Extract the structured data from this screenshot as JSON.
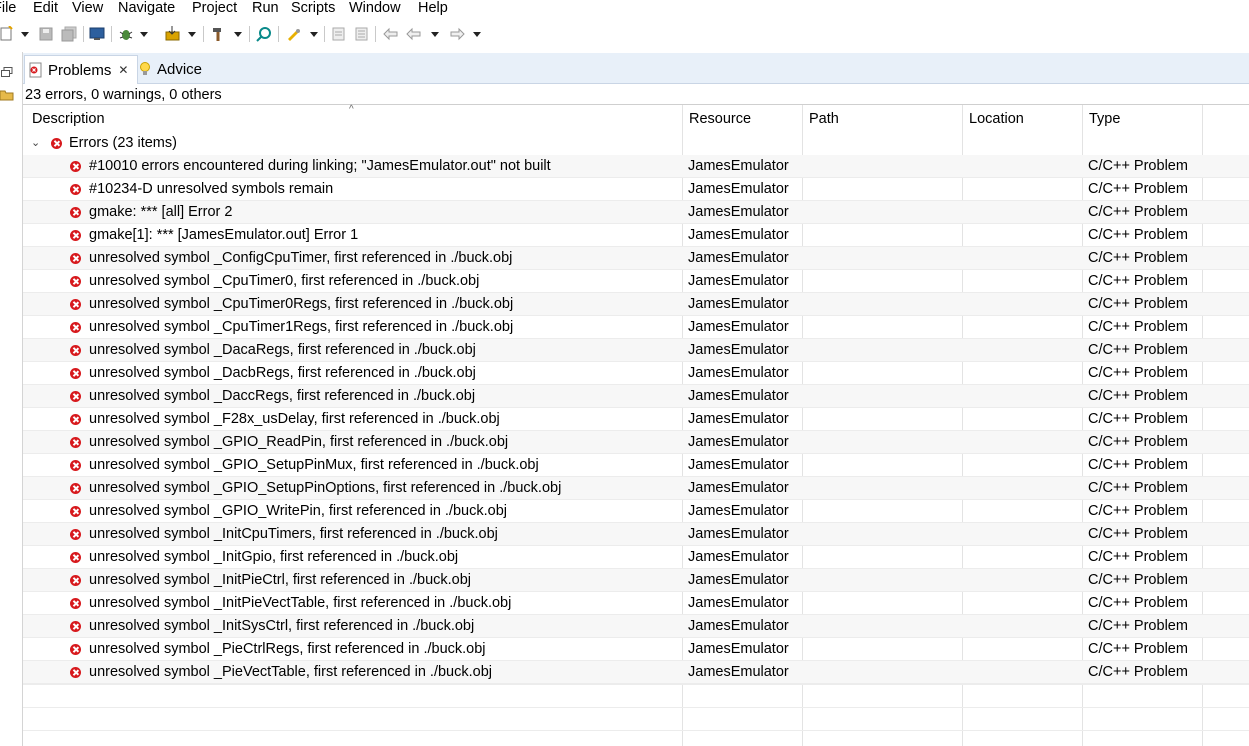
{
  "menu": [
    "File",
    "Edit",
    "View",
    "Navigate",
    "Project",
    "Run",
    "Scripts",
    "Window",
    "Help"
  ],
  "tabs": {
    "problems": "Problems",
    "advice": "Advice"
  },
  "summary": "23 errors, 0 warnings, 0 others",
  "columns": {
    "description": "Description",
    "resource": "Resource",
    "path": "Path",
    "location": "Location",
    "type": "Type"
  },
  "group": {
    "label": "Errors (23 items)"
  },
  "rows": [
    {
      "description": "#10010 errors encountered during linking; \"JamesEmulator.out\" not built",
      "resource": "JamesEmulator",
      "type": "C/C++ Problem"
    },
    {
      "description": "#10234-D unresolved symbols remain",
      "resource": "JamesEmulator",
      "type": "C/C++ Problem"
    },
    {
      "description": "gmake: *** [all] Error 2",
      "resource": "JamesEmulator",
      "type": "C/C++ Problem"
    },
    {
      "description": "gmake[1]: *** [JamesEmulator.out] Error 1",
      "resource": "JamesEmulator",
      "type": "C/C++ Problem"
    },
    {
      "description": "unresolved symbol _ConfigCpuTimer, first referenced in ./buck.obj",
      "resource": "JamesEmulator",
      "type": "C/C++ Problem"
    },
    {
      "description": "unresolved symbol _CpuTimer0, first referenced in ./buck.obj",
      "resource": "JamesEmulator",
      "type": "C/C++ Problem"
    },
    {
      "description": "unresolved symbol _CpuTimer0Regs, first referenced in ./buck.obj",
      "resource": "JamesEmulator",
      "type": "C/C++ Problem"
    },
    {
      "description": "unresolved symbol _CpuTimer1Regs, first referenced in ./buck.obj",
      "resource": "JamesEmulator",
      "type": "C/C++ Problem"
    },
    {
      "description": "unresolved symbol _DacaRegs, first referenced in ./buck.obj",
      "resource": "JamesEmulator",
      "type": "C/C++ Problem"
    },
    {
      "description": "unresolved symbol _DacbRegs, first referenced in ./buck.obj",
      "resource": "JamesEmulator",
      "type": "C/C++ Problem"
    },
    {
      "description": "unresolved symbol _DaccRegs, first referenced in ./buck.obj",
      "resource": "JamesEmulator",
      "type": "C/C++ Problem"
    },
    {
      "description": "unresolved symbol _F28x_usDelay, first referenced in ./buck.obj",
      "resource": "JamesEmulator",
      "type": "C/C++ Problem"
    },
    {
      "description": "unresolved symbol _GPIO_ReadPin, first referenced in ./buck.obj",
      "resource": "JamesEmulator",
      "type": "C/C++ Problem"
    },
    {
      "description": "unresolved symbol _GPIO_SetupPinMux, first referenced in ./buck.obj",
      "resource": "JamesEmulator",
      "type": "C/C++ Problem"
    },
    {
      "description": "unresolved symbol _GPIO_SetupPinOptions, first referenced in ./buck.obj",
      "resource": "JamesEmulator",
      "type": "C/C++ Problem"
    },
    {
      "description": "unresolved symbol _GPIO_WritePin, first referenced in ./buck.obj",
      "resource": "JamesEmulator",
      "type": "C/C++ Problem"
    },
    {
      "description": "unresolved symbol _InitCpuTimers, first referenced in ./buck.obj",
      "resource": "JamesEmulator",
      "type": "C/C++ Problem"
    },
    {
      "description": "unresolved symbol _InitGpio, first referenced in ./buck.obj",
      "resource": "JamesEmulator",
      "type": "C/C++ Problem"
    },
    {
      "description": "unresolved symbol _InitPieCtrl, first referenced in ./buck.obj",
      "resource": "JamesEmulator",
      "type": "C/C++ Problem"
    },
    {
      "description": "unresolved symbol _InitPieVectTable, first referenced in ./buck.obj",
      "resource": "JamesEmulator",
      "type": "C/C++ Problem"
    },
    {
      "description": "unresolved symbol _InitSysCtrl, first referenced in ./buck.obj",
      "resource": "JamesEmulator",
      "type": "C/C++ Problem"
    },
    {
      "description": "unresolved symbol _PieCtrlRegs, first referenced in ./buck.obj",
      "resource": "JamesEmulator",
      "type": "C/C++ Problem"
    },
    {
      "description": "unresolved symbol _PieVectTable, first referenced in ./buck.obj",
      "resource": "JamesEmulator",
      "type": "C/C++ Problem"
    }
  ],
  "colors": {
    "error": "#d7191d",
    "tabbar": "#e8f0f9",
    "alt_row": "#f7f7f7"
  },
  "icons": [
    "new-file-icon",
    "save-icon",
    "save-all-icon",
    "terminal-icon",
    "debug-icon",
    "flash-icon",
    "build-icon",
    "search-icon",
    "launch-icon",
    "back-icon",
    "forward-icon",
    "problems-icon",
    "advice-icon",
    "close-icon",
    "error-icon",
    "collapse-icon"
  ]
}
